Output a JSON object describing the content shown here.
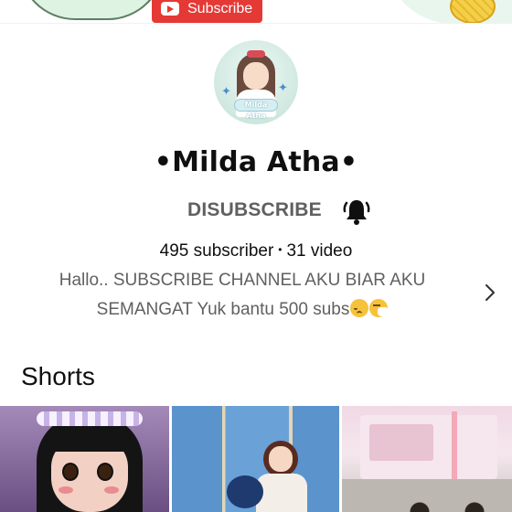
{
  "banner": {
    "subscribe_label": "Subscribe",
    "brand_color": "#e53935"
  },
  "channel": {
    "name": "•Milda Atha•",
    "avatar_tag": "Milda Atha",
    "unsubscribe_label": "DISUBSCRIBE",
    "bell_icon": "bell-ringing-icon",
    "subscribers": "495 subscriber",
    "separator": "•",
    "videos": "31 video",
    "description_line1": "Hallo.. SUBSCRIBE CHANNEL AKU BIAR AKU",
    "description_line2": "SEMANGAT Yuk bantu 500 subs",
    "description_emojis": [
      "pensive-face-emoji",
      "sneezing-face-emoji"
    ],
    "more_icon": "chevron-right-icon"
  },
  "shorts": {
    "title": "Shorts",
    "items": [
      {
        "thumbnail": "anime-girl-portrait"
      },
      {
        "thumbnail": "classroom-scene"
      },
      {
        "thumbnail": "pink-room-scene"
      }
    ]
  },
  "colors": {
    "text_primary": "#0f0f0f",
    "text_secondary": "#606060",
    "background": "#ffffff"
  }
}
